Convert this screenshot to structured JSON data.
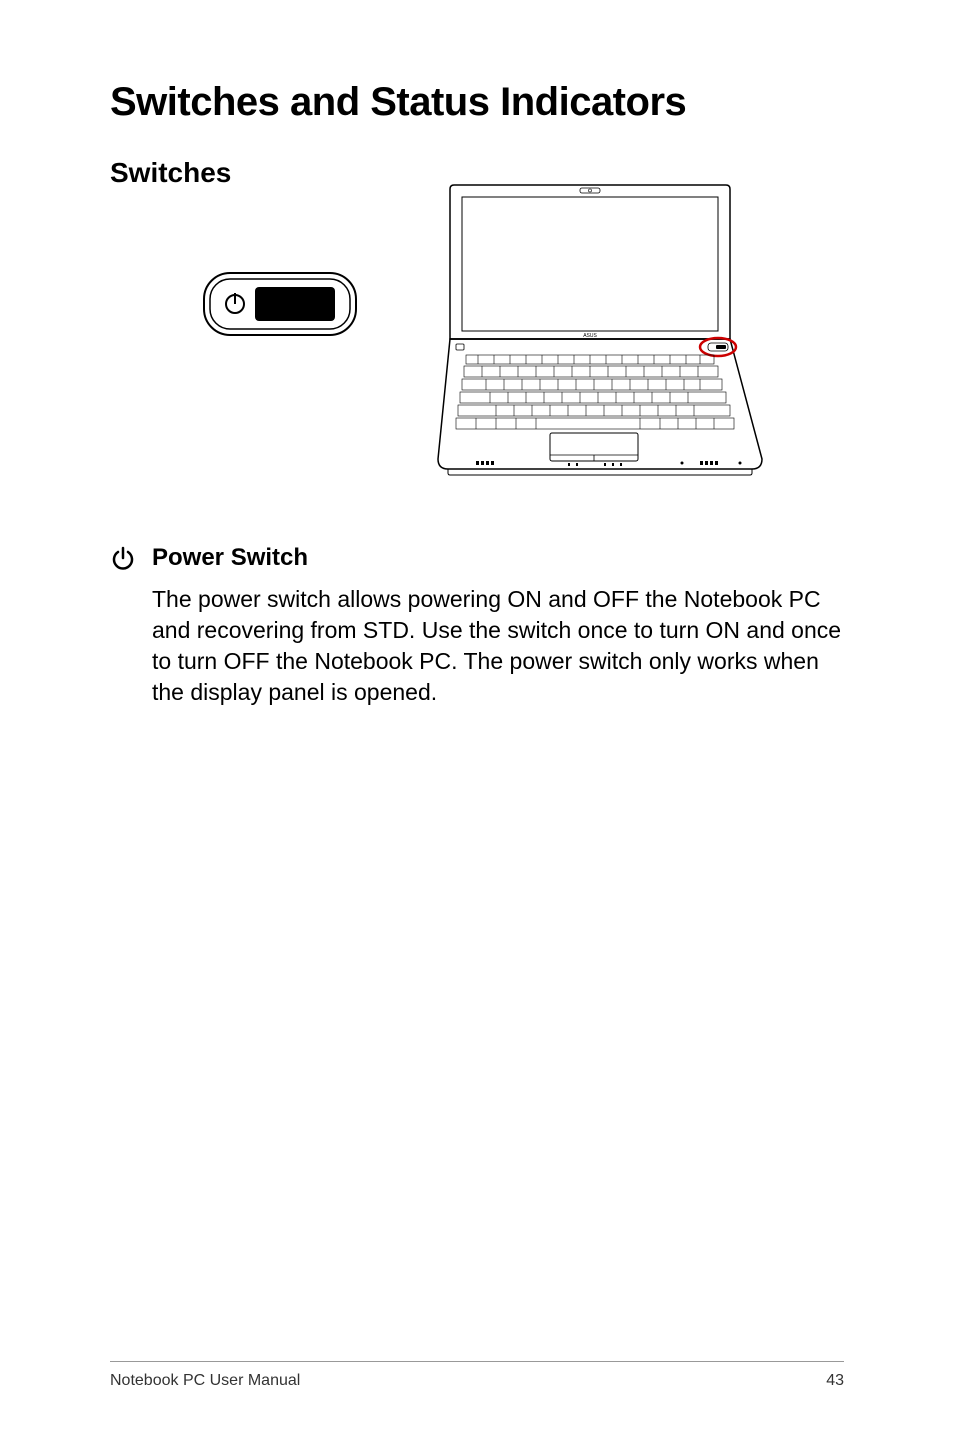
{
  "heading": "Switches and Status Indicators",
  "subheading": "Switches",
  "section": {
    "title": "Power Switch",
    "body": "The power switch allows powering ON and OFF the Notebook PC and recovering from STD. Use the switch once to turn ON and once to turn OFF the Notebook PC. The power switch only works when the display panel is opened."
  },
  "footer": {
    "left": "Notebook PC User Manual",
    "page_number": "43"
  },
  "icons": {
    "power": "power-icon"
  }
}
